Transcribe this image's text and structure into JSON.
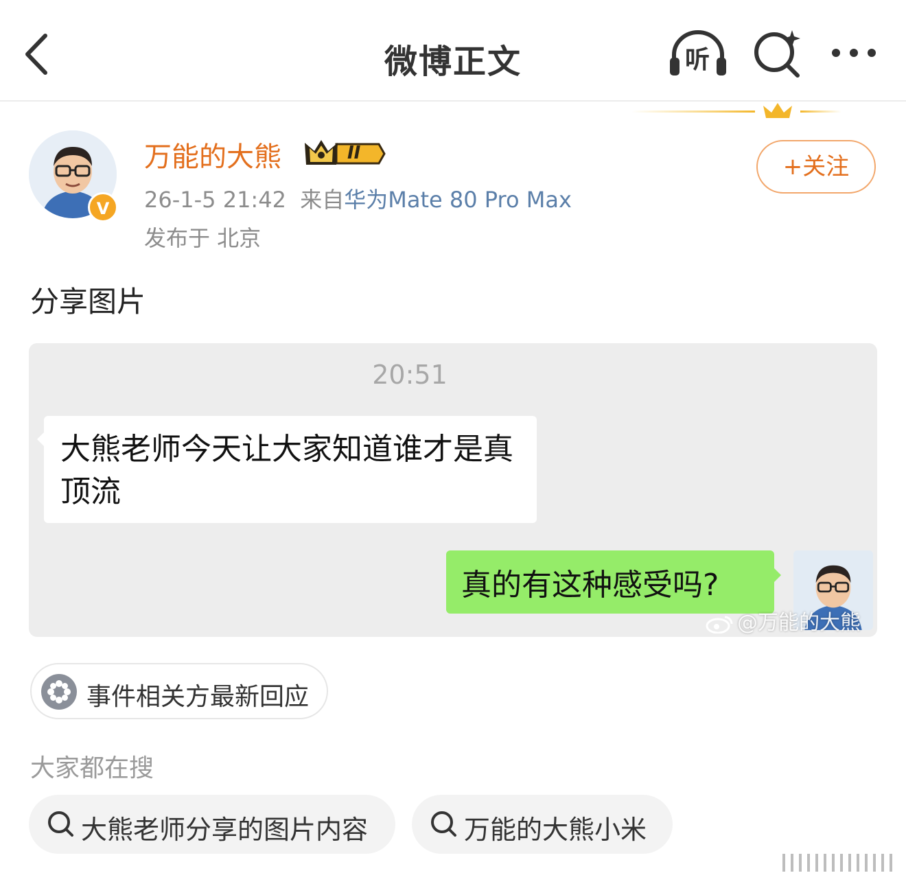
{
  "header": {
    "title": "微博正文",
    "back_icon": "chevron-left-icon",
    "listen_label": "听",
    "search_icon": "ai-search-icon",
    "more_icon": "more-dots-icon"
  },
  "author": {
    "name": "万能的大熊",
    "badge_label": "II",
    "verified_label": "V",
    "time": "26-1-5 21:42",
    "from_prefix": "来自",
    "device": "华为Mate 80 Pro Max",
    "location": "发布于 北京",
    "follow_label": "+关注"
  },
  "post": {
    "text": "分享图片"
  },
  "shared_image": {
    "time": "20:51",
    "incoming_message": "大熊老师今天让大家知道谁才是真顶流",
    "outgoing_message": "真的有这种感受吗?",
    "watermark": "@万能的大熊"
  },
  "topic": {
    "label": "事件相关方最新回应"
  },
  "searches": {
    "heading": "大家都在搜",
    "items": [
      {
        "label": "大熊老师分享的图片内容"
      },
      {
        "label": "万能的大熊小米"
      }
    ]
  },
  "colors": {
    "accent": "#e36f1d",
    "device_link": "#5b7fa9",
    "bubble_green": "#95ec69",
    "chat_bg": "#ededed"
  }
}
